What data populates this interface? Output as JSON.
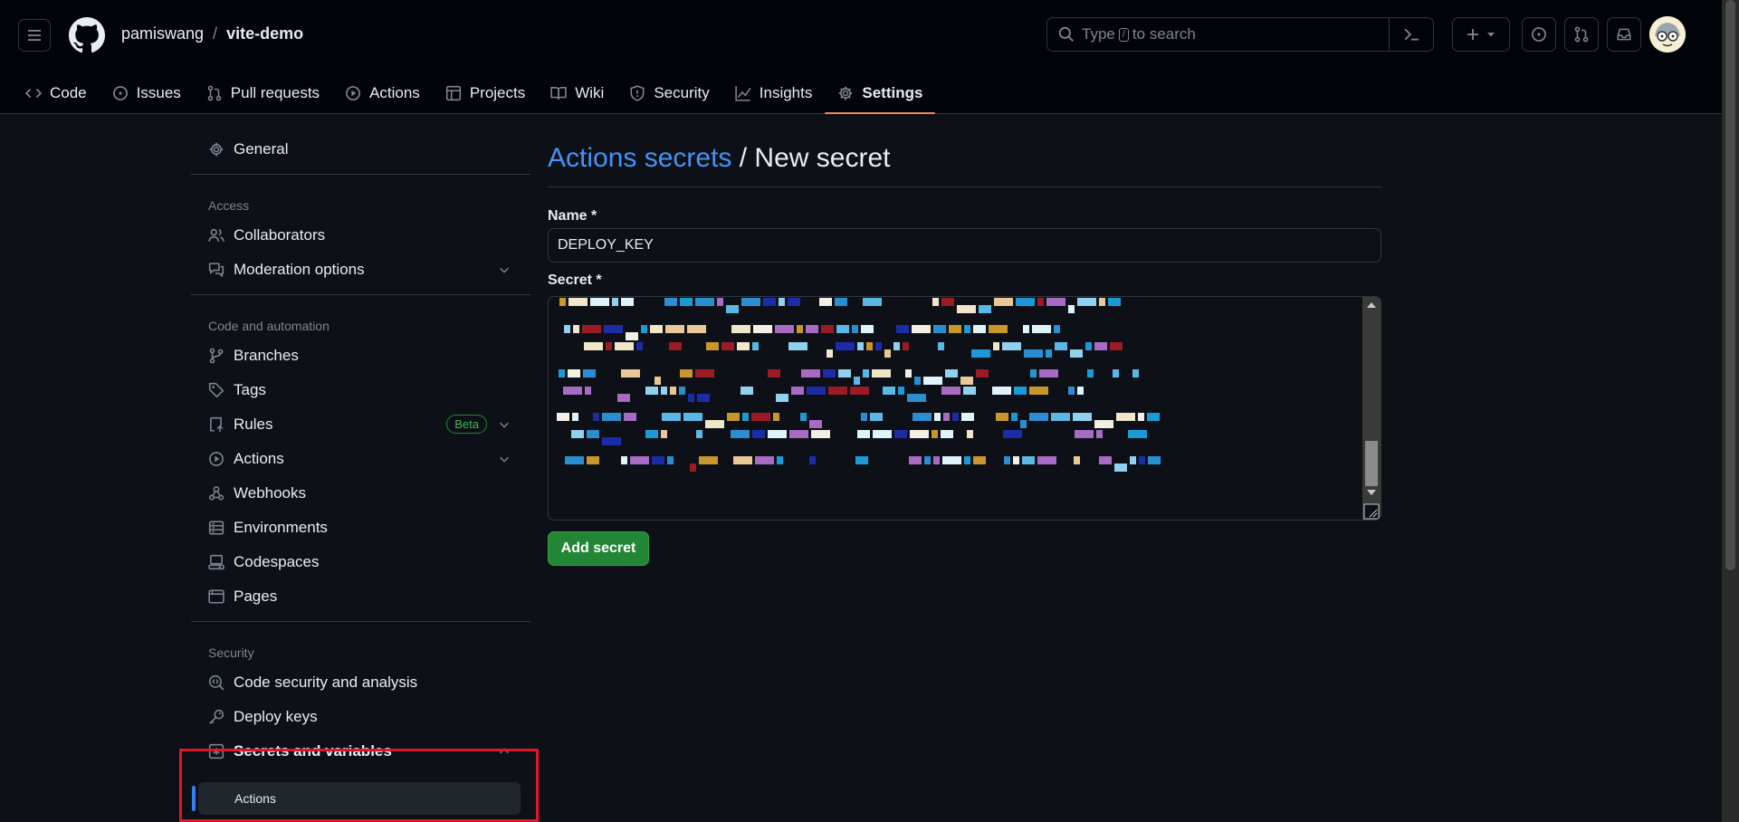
{
  "header": {
    "owner": "pamiswang",
    "separator": "/",
    "repo": "vite-demo",
    "search": {
      "prefix": "Type",
      "key": "/",
      "suffix": "to search"
    }
  },
  "tabs": [
    {
      "label": "Code",
      "icon": "code-icon"
    },
    {
      "label": "Issues",
      "icon": "issue-icon"
    },
    {
      "label": "Pull requests",
      "icon": "pull-request-icon"
    },
    {
      "label": "Actions",
      "icon": "play-icon"
    },
    {
      "label": "Projects",
      "icon": "table-icon"
    },
    {
      "label": "Wiki",
      "icon": "book-icon"
    },
    {
      "label": "Security",
      "icon": "shield-icon"
    },
    {
      "label": "Insights",
      "icon": "graph-icon"
    },
    {
      "label": "Settings",
      "icon": "gear-icon",
      "active": true
    }
  ],
  "sidebar": {
    "general": "General",
    "access_heading": "Access",
    "collaborators": "Collaborators",
    "moderation": "Moderation options",
    "code_heading": "Code and automation",
    "branches": "Branches",
    "tags": "Tags",
    "rules": "Rules",
    "beta": "Beta",
    "actions": "Actions",
    "webhooks": "Webhooks",
    "environments": "Environments",
    "codespaces": "Codespaces",
    "pages": "Pages",
    "security_heading": "Security",
    "code_security": "Code security and analysis",
    "deploy_keys": "Deploy keys",
    "secrets": "Secrets and variables",
    "secrets_actions": "Actions"
  },
  "main": {
    "title_link": "Actions secrets",
    "title_rest": " / New secret",
    "name_label": "Name *",
    "name_value": "DEPLOY_KEY",
    "secret_label": "Secret *",
    "add_button": "Add secret"
  },
  "colors": {
    "accent": "#4493f8",
    "primary_button": "#238636",
    "active_tab": "#f78166",
    "highlight": "#e0162b"
  }
}
